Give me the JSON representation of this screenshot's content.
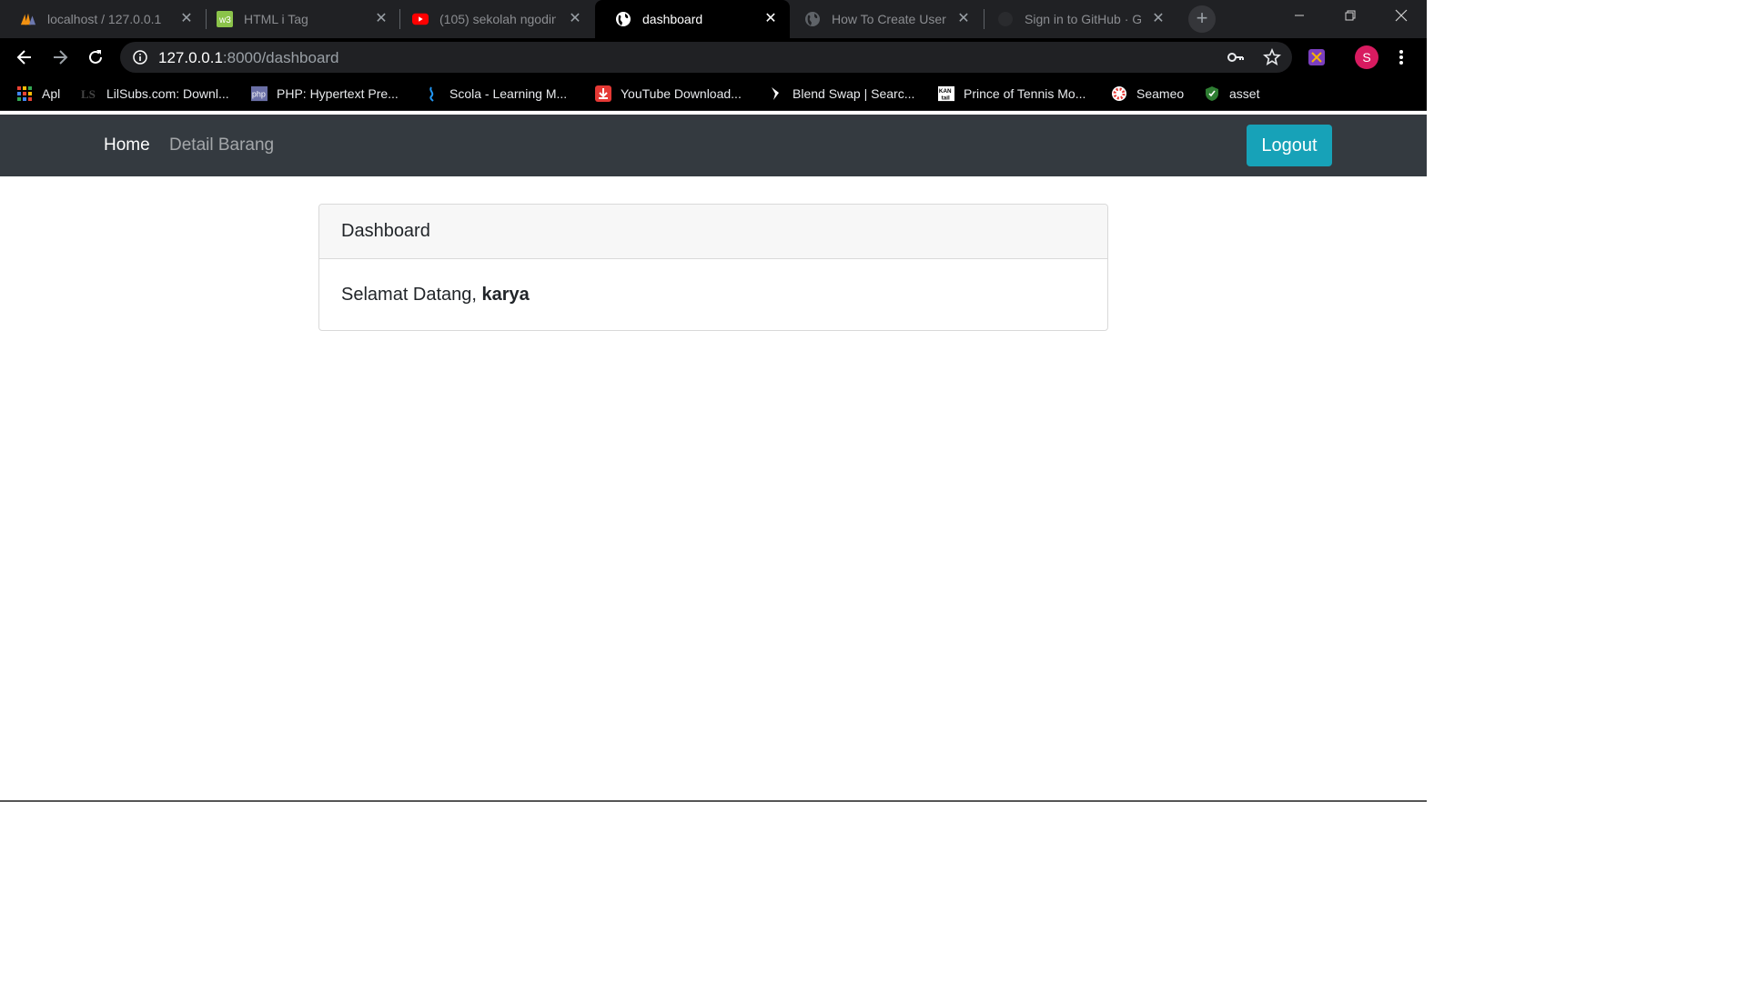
{
  "browser": {
    "tabs": [
      {
        "title": "localhost / 127.0.0.1",
        "icon": "phpmyadmin-icon",
        "active": false
      },
      {
        "title": "HTML i Tag",
        "icon": "w3schools-icon",
        "active": false
      },
      {
        "title": "(105) sekolah ngoding",
        "icon": "youtube-icon",
        "active": false
      },
      {
        "title": "dashboard",
        "icon": "globe-icon",
        "active": true
      },
      {
        "title": "How To Create User",
        "icon": "globe-icon",
        "active": false
      },
      {
        "title": "Sign in to GitHub · GitHub",
        "icon": "github-icon",
        "active": false
      }
    ],
    "url_host": "127.0.0.1",
    "url_rest": ":8000/dashboard",
    "profile_initial": "S",
    "bookmarks": [
      {
        "label": "Apl",
        "icon": "apps-grid-icon"
      },
      {
        "label": "LilSubs.com: Downl...",
        "icon": "lilsubs-icon"
      },
      {
        "label": "PHP: Hypertext Pre...",
        "icon": "php-icon"
      },
      {
        "label": "Scola - Learning M...",
        "icon": "scola-icon"
      },
      {
        "label": "YouTube Download...",
        "icon": "download-icon"
      },
      {
        "label": "Blend Swap | Searc...",
        "icon": "blendswap-icon"
      },
      {
        "label": "Prince of Tennis Mo...",
        "icon": "kanal-icon"
      },
      {
        "label": "Seameo",
        "icon": "seameo-icon"
      },
      {
        "label": "asset",
        "icon": "shield-icon"
      }
    ]
  },
  "navbar": {
    "home": "Home",
    "detail": "Detail Barang",
    "logout": "Logout"
  },
  "card": {
    "header": "Dashboard",
    "greeting": "Selamat Datang, ",
    "username": "karya"
  },
  "colors": {
    "navbar_bg": "#343a40",
    "logout_bg": "#17a2b8",
    "card_header_bg": "#f7f7f7"
  }
}
